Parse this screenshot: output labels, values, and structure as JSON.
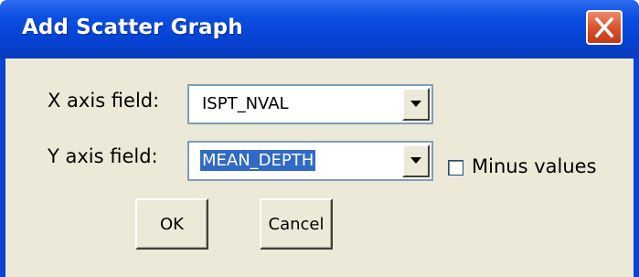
{
  "window": {
    "title": "Add Scatter Graph"
  },
  "x_axis": {
    "label": "X axis field:",
    "value": "ISPT_NVAL"
  },
  "y_axis": {
    "label": "Y axis field:",
    "value": "MEAN_DEPTH"
  },
  "minus_values": {
    "label": "Minus values",
    "checked": false
  },
  "buttons": {
    "ok_label": "OK",
    "cancel_label": "Cancel"
  },
  "colors": {
    "titlebar": "#0541d2",
    "client_bg": "#ece9d8",
    "selection": "#316ac5",
    "close_button": "#d9522c"
  },
  "icons": {
    "close": "close-icon",
    "dropdown": "chevron-down-icon"
  }
}
